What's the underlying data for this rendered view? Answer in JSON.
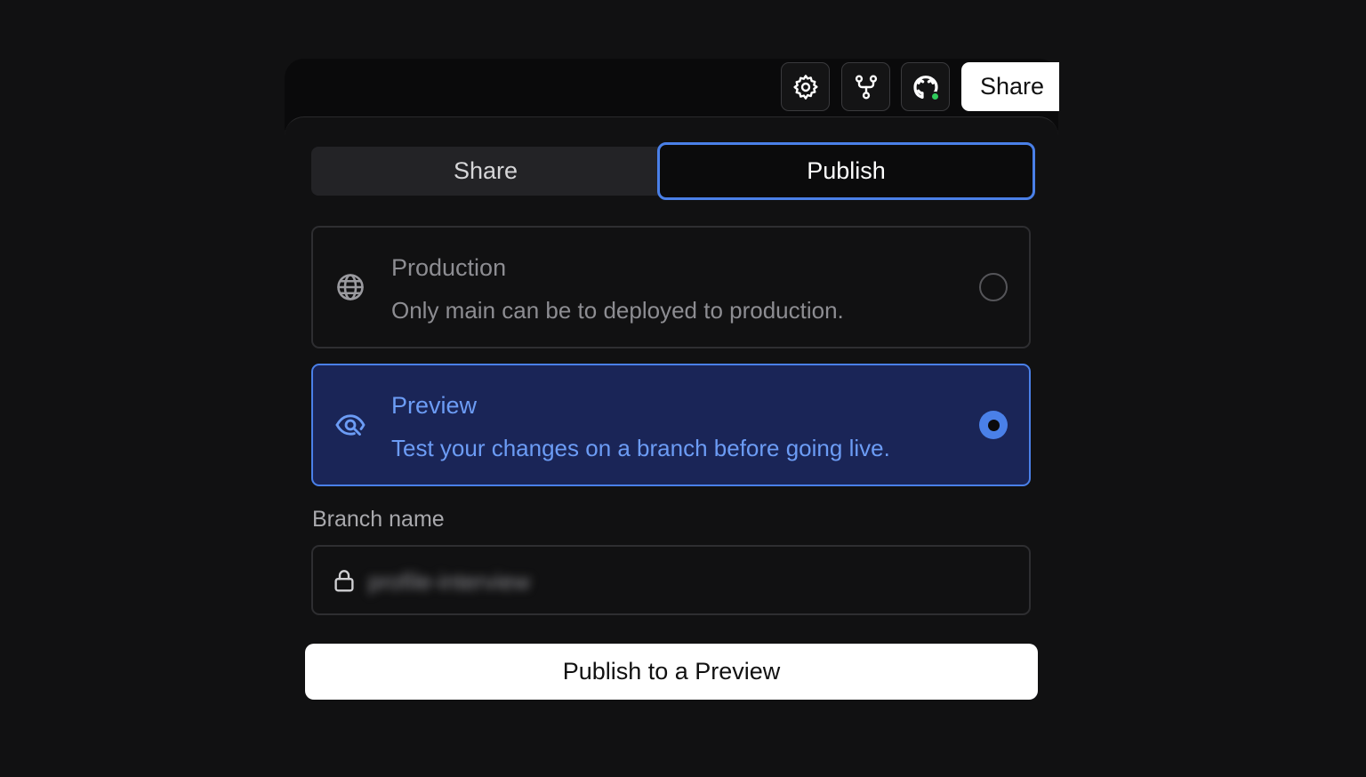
{
  "toolbar": {
    "share_label": "Share",
    "icons": [
      "gear-icon",
      "git-fork-icon",
      "github-icon"
    ],
    "github_status_color": "#2fcb5b"
  },
  "tabs": [
    {
      "label": "Share",
      "active": false
    },
    {
      "label": "Publish",
      "active": true
    }
  ],
  "options": [
    {
      "title": "Production",
      "description": "Only main can be to deployed to production.",
      "icon": "globe-icon",
      "selected": false
    },
    {
      "title": "Preview",
      "description": "Test your changes on a branch before going live.",
      "icon": "eye-icon",
      "selected": true
    }
  ],
  "branch": {
    "label": "Branch name",
    "value": "profile-interview",
    "icon": "lock-icon"
  },
  "publish_button_label": "Publish to a Preview",
  "colors": {
    "accent": "#4a80e8",
    "selected_bg": "#1a2557",
    "selected_text": "#6c9cf5",
    "background": "#111112"
  }
}
